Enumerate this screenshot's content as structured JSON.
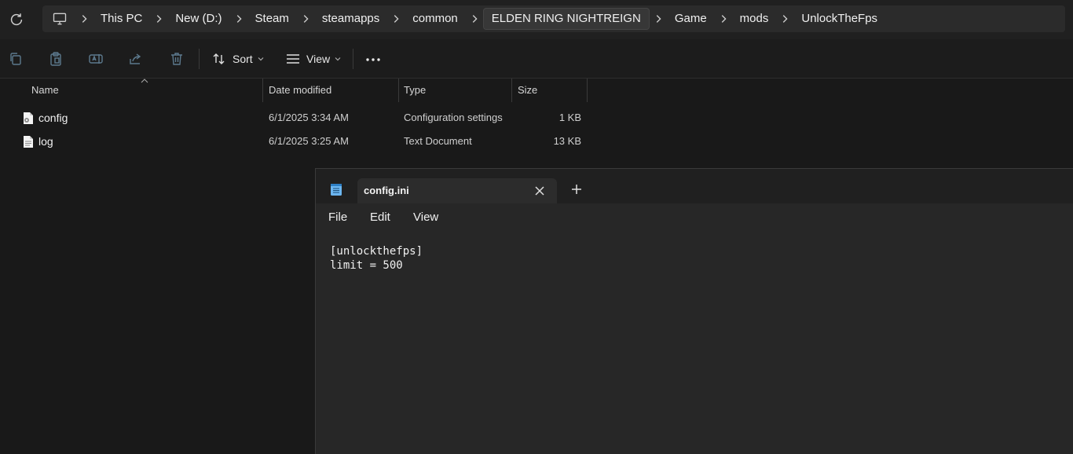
{
  "address_bar": {
    "segments": [
      "This PC",
      "New (D:)",
      "Steam",
      "steamapps",
      "common",
      "ELDEN RING NIGHTREIGN",
      "Game",
      "mods",
      "UnlockTheFps"
    ]
  },
  "toolbar": {
    "sort_label": "Sort",
    "view_label": "View"
  },
  "file_list": {
    "columns": [
      "Name",
      "Date modified",
      "Type",
      "Size"
    ],
    "rows": [
      {
        "name": "config",
        "date": "6/1/2025 3:34 AM",
        "type": "Configuration settings",
        "size": "1 KB",
        "icon": "ini-file-icon"
      },
      {
        "name": "log",
        "date": "6/1/2025 3:25 AM",
        "type": "Text Document",
        "size": "13 KB",
        "icon": "text-file-icon"
      }
    ]
  },
  "notepad": {
    "tab_title": "config.ini",
    "menu": [
      "File",
      "Edit",
      "View"
    ],
    "lines": [
      "[unlockthefps]",
      "limit = 500"
    ]
  }
}
